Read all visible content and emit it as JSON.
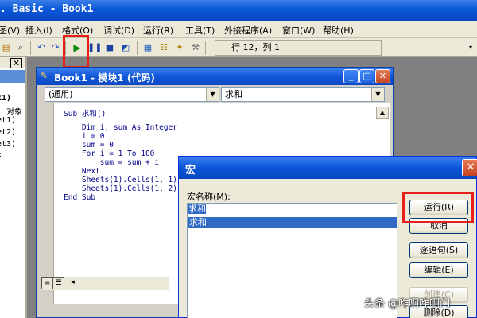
{
  "app": {
    "title": ". Basic - Book1"
  },
  "menu": {
    "items": [
      "图(V)",
      "插入(I)",
      "格式(O)",
      "调试(D)",
      "运行(R)",
      "工具(T)",
      "外接程序(A)",
      "窗口(W)",
      "帮助(H)"
    ]
  },
  "toolbar": {
    "position_text": "行 12，列 1",
    "run_icon": "play-icon"
  },
  "project": {
    "lines": [
      "k1)",
      "1 对象",
      "et1)",
      "et2)",
      "et3)",
      "k"
    ]
  },
  "code_window": {
    "title": "Book1 - 模块1 (代码)",
    "object_combo": "(通用)",
    "proc_combo": "求和",
    "lines": [
      "Sub 求和()",
      "    Dim i, sum As Integer",
      "    i = 0",
      "    sum = 0",
      "    For i = 1 To 100",
      "        sum = sum + i",
      "    Next i",
      "    Sheets(1).Cells(1, 1) =",
      "    Sheets(1).Cells(1, 2) =",
      "End Sub"
    ]
  },
  "macro_dialog": {
    "title": "宏",
    "name_label": "宏名称(M):",
    "name_value": "求和",
    "list_items": [
      "求和"
    ],
    "buttons": {
      "run": "运行(R)",
      "cancel": "取消",
      "step": "逐语句(S)",
      "edit": "编辑(E)",
      "create": "创建(C)",
      "delete": "删除(D)"
    }
  },
  "watermark": "头条 @咋啊咋啊门",
  "colors": {
    "highlight": "#e8201c",
    "title_blue": "#0a57d8",
    "selection": "#316ac5"
  }
}
